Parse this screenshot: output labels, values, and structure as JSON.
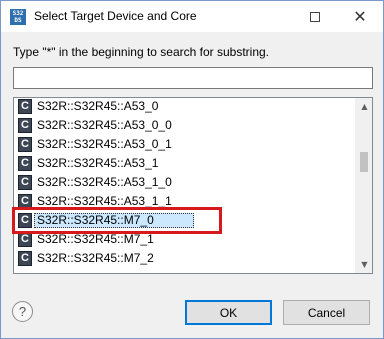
{
  "window": {
    "title": "Select Target Device and Core",
    "app_icon_text": "S32\nDS"
  },
  "hint": "Type \"*\" in the beginning to search for substring.",
  "search": {
    "value": "",
    "placeholder": ""
  },
  "list": {
    "items": [
      {
        "label": "S32R::S32R45::A53_0"
      },
      {
        "label": "S32R::S32R45::A53_0_0"
      },
      {
        "label": "S32R::S32R45::A53_0_1"
      },
      {
        "label": "S32R::S32R45::A53_1"
      },
      {
        "label": "S32R::S32R45::A53_1_0"
      },
      {
        "label": "S32R::S32R45::A53_1_1"
      },
      {
        "label": "S32R::S32R45::M7_0",
        "selected": true
      },
      {
        "label": "S32R::S32R45::M7_1"
      },
      {
        "label": "S32R::S32R45::M7_2"
      }
    ],
    "item_icon_letter": "C"
  },
  "buttons": {
    "help": "?",
    "ok": "OK",
    "cancel": "Cancel"
  },
  "colors": {
    "highlight_box": "#d7191c",
    "selection": "#cce8ff",
    "ok_border": "#0078d7"
  }
}
